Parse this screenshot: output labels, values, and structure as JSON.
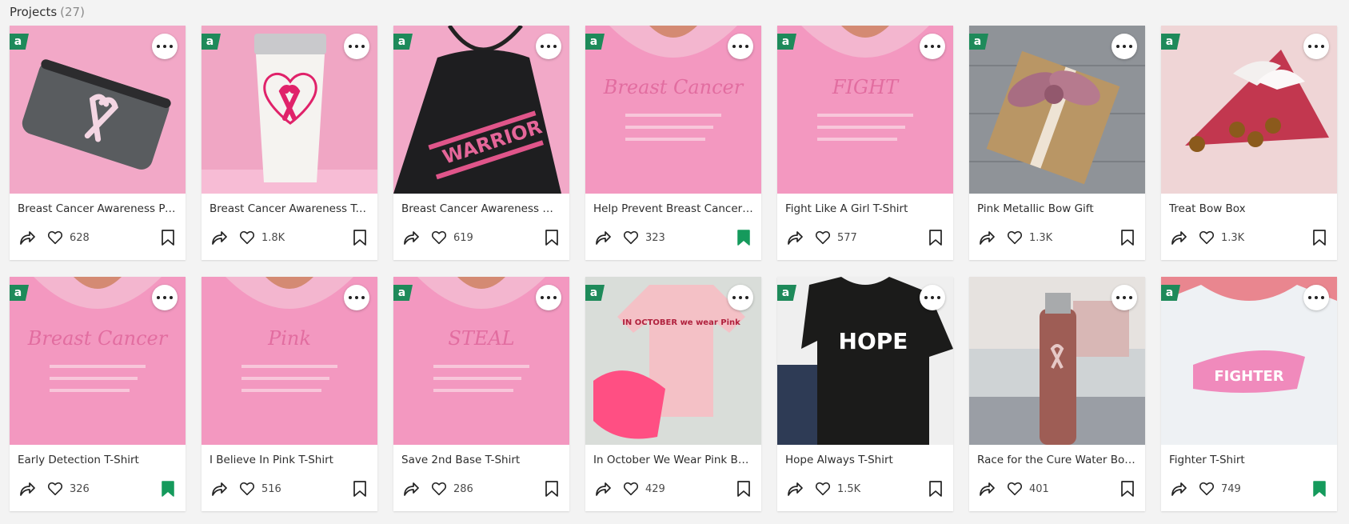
{
  "header": {
    "title": "Projects",
    "count": "(27)"
  },
  "colors": {
    "accent": "#1e8a5a",
    "saved": "#159a5c",
    "pink": "#f29bc4"
  },
  "projects": [
    {
      "title": "Breast Cancer Awareness Po...",
      "likes": "628",
      "saved": false,
      "badge": "a",
      "thumb": "pouch"
    },
    {
      "title": "Breast Cancer Awareness Tu...",
      "likes": "1.8K",
      "saved": false,
      "badge": "a",
      "thumb": "tumbler"
    },
    {
      "title": "Breast Cancer Awareness W...",
      "likes": "619",
      "saved": false,
      "badge": "a",
      "thumb": "apron",
      "thumb_text": "WARRIOR"
    },
    {
      "title": "Help Prevent Breast Cancer ...",
      "likes": "323",
      "saved": true,
      "badge": "a",
      "thumb": "shirt-pink",
      "thumb_text": "Breast Cancer"
    },
    {
      "title": "Fight Like A Girl T-Shirt",
      "likes": "577",
      "saved": false,
      "badge": "a",
      "thumb": "shirt-pink",
      "thumb_text": "FIGHT"
    },
    {
      "title": "Pink Metallic Bow Gift",
      "likes": "1.3K",
      "saved": false,
      "badge": "a",
      "thumb": "bowgift"
    },
    {
      "title": "Treat Bow Box",
      "likes": "1.3K",
      "saved": false,
      "badge": "a",
      "thumb": "treatbox"
    },
    {
      "title": "Early Detection T-Shirt",
      "likes": "326",
      "saved": true,
      "badge": "a",
      "thumb": "shirt-pink",
      "thumb_text": "Breast Cancer"
    },
    {
      "title": "I Believe In Pink T-Shirt",
      "likes": "516",
      "saved": false,
      "badge": "",
      "thumb": "shirt-pink",
      "thumb_text": "Pink"
    },
    {
      "title": "Save 2nd Base T-Shirt",
      "likes": "286",
      "saved": false,
      "badge": "a",
      "thumb": "shirt-pink",
      "thumb_text": "STEAL"
    },
    {
      "title": "In October We Wear Pink Ba...",
      "likes": "429",
      "saved": false,
      "badge": "a",
      "thumb": "onesie",
      "thumb_text": "IN OCTOBER we wear Pink"
    },
    {
      "title": "Hope Always T-Shirt",
      "likes": "1.5K",
      "saved": false,
      "badge": "a",
      "thumb": "shirt-black",
      "thumb_text": "HOPE"
    },
    {
      "title": "Race for the Cure Water Bottle",
      "likes": "401",
      "saved": false,
      "badge": "",
      "thumb": "bottle"
    },
    {
      "title": "Fighter T-Shirt",
      "likes": "749",
      "saved": true,
      "badge": "a",
      "thumb": "shirt-white",
      "thumb_text": "FIGHTER"
    }
  ]
}
